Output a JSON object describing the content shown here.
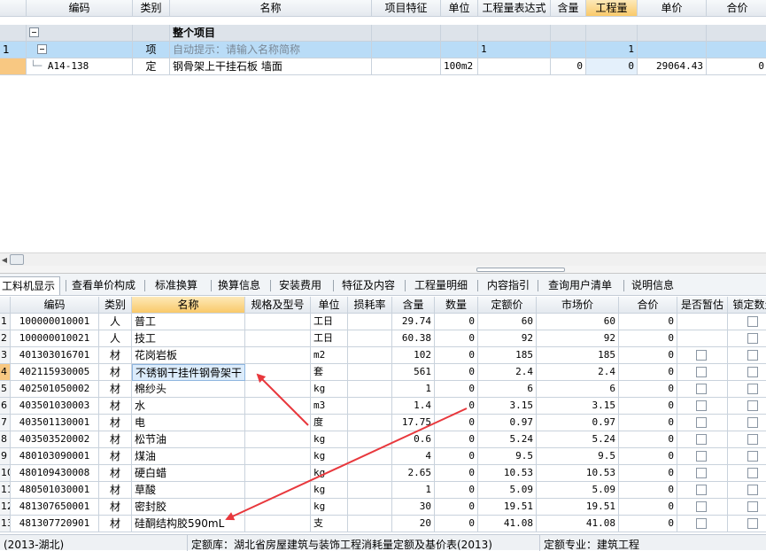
{
  "top_grid": {
    "headers": [
      "编码",
      "类别",
      "名称",
      "项目特征",
      "单位",
      "工程量表达式",
      "含量",
      "工程量",
      "单价",
      "合价"
    ],
    "active_header": "工程量",
    "summary_row": {
      "name": "整个项目"
    },
    "item_row": {
      "num": "1",
      "type": "项",
      "name_hint": "自动提示：请输入名称简称",
      "expression": "1",
      "quantity": "1"
    },
    "quota_row": {
      "code": "A14-138",
      "type": "定",
      "name": "钢骨架上干挂石板 墙面",
      "unit": "100m2",
      "content": "0",
      "quantity": "0",
      "price": "29064.43",
      "total": "0"
    }
  },
  "tabs": [
    {
      "label": "工料机显示",
      "active": true
    },
    {
      "label": "查看单价构成"
    },
    {
      "label": "标准换算"
    },
    {
      "label": "换算信息"
    },
    {
      "label": "安装费用"
    },
    {
      "label": "特征及内容"
    },
    {
      "label": "工程量明细"
    },
    {
      "label": "内容指引"
    },
    {
      "label": "查询用户清单"
    },
    {
      "label": "说明信息"
    }
  ],
  "bottom_grid": {
    "headers": [
      "编码",
      "类别",
      "名称",
      "规格及型号",
      "单位",
      "损耗率",
      "含量",
      "数量",
      "定额价",
      "市场价",
      "合价",
      "是否暂估",
      "锁定数量"
    ],
    "active_header": "名称",
    "rows": [
      {
        "num": "1",
        "code": "100000010001",
        "type": "人",
        "name": "普工",
        "unit": "工日",
        "content": "29.74",
        "qty": "0",
        "quota_price": "60",
        "market_price": "60",
        "total": "0",
        "estimate": false
      },
      {
        "num": "2",
        "code": "100000010021",
        "type": "人",
        "name": "技工",
        "unit": "工日",
        "content": "60.38",
        "qty": "0",
        "quota_price": "92",
        "market_price": "92",
        "total": "0",
        "estimate": false
      },
      {
        "num": "3",
        "code": "401303016701",
        "type": "材",
        "name": "花岗岩板",
        "unit": "m2",
        "content": "102",
        "qty": "0",
        "quota_price": "185",
        "market_price": "185",
        "total": "0",
        "estimate": true
      },
      {
        "num": "4",
        "code": "402115930005",
        "type": "材",
        "name": "不锈钢干挂件钢骨架干",
        "unit": "套",
        "content": "561",
        "qty": "0",
        "quota_price": "2.4",
        "market_price": "2.4",
        "total": "0",
        "estimate": true
      },
      {
        "num": "5",
        "code": "402501050002",
        "type": "材",
        "name": "棉纱头",
        "unit": "kg",
        "content": "1",
        "qty": "0",
        "quota_price": "6",
        "market_price": "6",
        "total": "0",
        "estimate": true
      },
      {
        "num": "6",
        "code": "403501030003",
        "type": "材",
        "name": "水",
        "unit": "m3",
        "content": "1.4",
        "qty": "0",
        "quota_price": "3.15",
        "market_price": "3.15",
        "total": "0",
        "estimate": true
      },
      {
        "num": "7",
        "code": "403501130001",
        "type": "材",
        "name": "电",
        "unit": "度",
        "content": "17.75",
        "qty": "0",
        "quota_price": "0.97",
        "market_price": "0.97",
        "total": "0",
        "estimate": true
      },
      {
        "num": "8",
        "code": "403503520002",
        "type": "材",
        "name": "松节油",
        "unit": "kg",
        "content": "0.6",
        "qty": "0",
        "quota_price": "5.24",
        "market_price": "5.24",
        "total": "0",
        "estimate": true
      },
      {
        "num": "9",
        "code": "480103090001",
        "type": "材",
        "name": "煤油",
        "unit": "kg",
        "content": "4",
        "qty": "0",
        "quota_price": "9.5",
        "market_price": "9.5",
        "total": "0",
        "estimate": true
      },
      {
        "num": "10",
        "code": "480109430008",
        "type": "材",
        "name": "硬白蜡",
        "unit": "kg",
        "content": "2.65",
        "qty": "0",
        "quota_price": "10.53",
        "market_price": "10.53",
        "total": "0",
        "estimate": true
      },
      {
        "num": "11",
        "code": "480501030001",
        "type": "材",
        "name": "草酸",
        "unit": "kg",
        "content": "1",
        "qty": "0",
        "quota_price": "5.09",
        "market_price": "5.09",
        "total": "0",
        "estimate": true
      },
      {
        "num": "12",
        "code": "481307650001",
        "type": "材",
        "name": "密封胶",
        "unit": "kg",
        "content": "30",
        "qty": "0",
        "quota_price": "19.51",
        "market_price": "19.51",
        "total": "0",
        "estimate": true
      },
      {
        "num": "13",
        "code": "481307720901",
        "type": "材",
        "name": "硅酮结构胶590mL",
        "unit": "支",
        "content": "20",
        "qty": "0",
        "quota_price": "41.08",
        "market_price": "41.08",
        "total": "0",
        "estimate": true
      }
    ]
  },
  "status_bar": {
    "left": "(2013-湖北)",
    "middle": "定额库：湖北省房屋建筑与装饰工程消耗量定额及基价表(2013)",
    "right": "定额专业：建筑工程"
  },
  "colors": {
    "annotation_arrow": "#e8383d",
    "selection_blue": "#b9dcf7",
    "active_header": "#f9c96a"
  }
}
